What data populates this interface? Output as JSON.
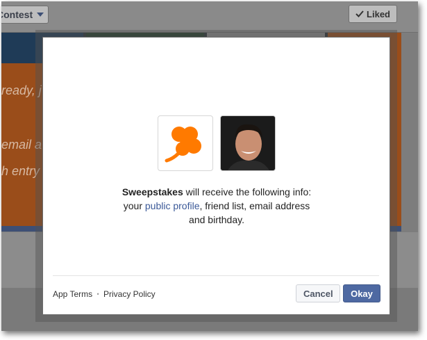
{
  "background_page": {
    "contest_label": "Contest",
    "liked_label": "Liked",
    "banner_lines": [
      "ready, j",
      "email a",
      "h entry"
    ]
  },
  "dialog": {
    "app_name": "Sweepstakes",
    "info_text": " will receive the following info:",
    "line2_prefix": "your ",
    "public_profile_link": "public profile",
    "line2_suffix": ", friend list, email address",
    "line3": "and birthday.",
    "app_terms_link": "App Terms",
    "separator": "•",
    "privacy_policy_link": "Privacy Policy",
    "cancel_label": "Cancel",
    "okay_label": "Okay"
  },
  "colors": {
    "brand_blue": "#3b5998",
    "okay_button": "#4e69a2",
    "clover_orange": "#ff7a00"
  }
}
